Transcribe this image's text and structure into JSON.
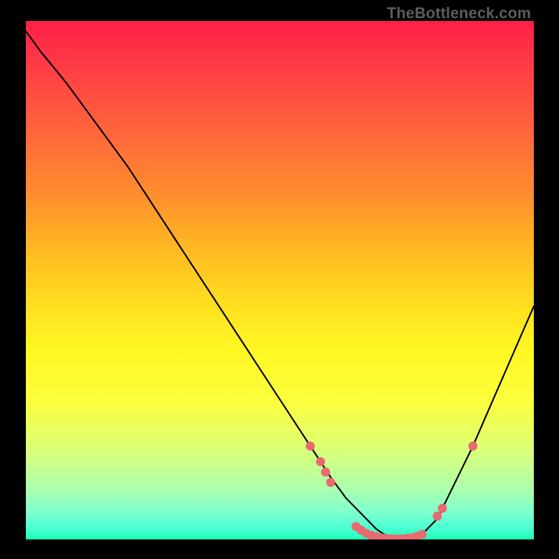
{
  "watermark": "TheBottleneck.com",
  "chart_data": {
    "type": "line",
    "title": "",
    "xlabel": "",
    "ylabel": "",
    "xlim": [
      0,
      100
    ],
    "ylim": [
      0,
      100
    ],
    "grid": false,
    "series": [
      {
        "name": "bottleneck-curve",
        "x": [
          0,
          3,
          8,
          14,
          20,
          26,
          32,
          38,
          44,
          50,
          56,
          60,
          63,
          66,
          69,
          72,
          75,
          78,
          81,
          84,
          88,
          92,
          96,
          100
        ],
        "values": [
          98,
          94,
          88,
          80,
          72,
          63,
          54,
          45,
          36,
          27,
          18,
          12,
          8,
          5,
          2,
          0,
          0,
          1,
          4,
          10,
          18,
          27,
          36,
          45
        ]
      }
    ],
    "markers": {
      "name": "highlight-dots",
      "color": "#e96a6f",
      "points": [
        {
          "x": 56,
          "y": 18
        },
        {
          "x": 58,
          "y": 15
        },
        {
          "x": 59,
          "y": 13
        },
        {
          "x": 60,
          "y": 11
        },
        {
          "x": 65,
          "y": 2.5
        },
        {
          "x": 66,
          "y": 1.8
        },
        {
          "x": 67,
          "y": 1.2
        },
        {
          "x": 68,
          "y": 0.8
        },
        {
          "x": 69,
          "y": 0.5
        },
        {
          "x": 70,
          "y": 0.3
        },
        {
          "x": 71,
          "y": 0.2
        },
        {
          "x": 72,
          "y": 0.1
        },
        {
          "x": 73,
          "y": 0.1
        },
        {
          "x": 74,
          "y": 0.1
        },
        {
          "x": 75,
          "y": 0.2
        },
        {
          "x": 76,
          "y": 0.3
        },
        {
          "x": 77,
          "y": 0.6
        },
        {
          "x": 78,
          "y": 1.0
        },
        {
          "x": 81,
          "y": 4.5
        },
        {
          "x": 82,
          "y": 6.0
        },
        {
          "x": 88,
          "y": 18
        }
      ]
    },
    "background_gradient": {
      "stops": [
        {
          "pos": 0.0,
          "color": "#ff1f47"
        },
        {
          "pos": 0.18,
          "color": "#ff5a3f"
        },
        {
          "pos": 0.33,
          "color": "#ff8c2e"
        },
        {
          "pos": 0.56,
          "color": "#ffe320"
        },
        {
          "pos": 0.73,
          "color": "#fbfe3c"
        },
        {
          "pos": 0.86,
          "color": "#c8ff8e"
        },
        {
          "pos": 0.95,
          "color": "#7affcf"
        },
        {
          "pos": 1.0,
          "color": "#1cffb5"
        }
      ]
    }
  }
}
